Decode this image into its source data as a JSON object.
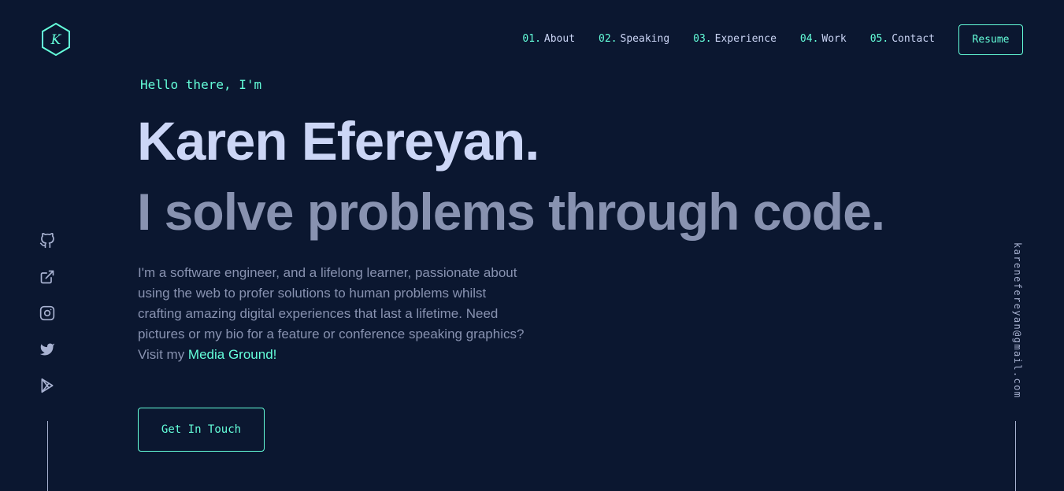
{
  "logo": {
    "letter": "K",
    "color": "#64ffda"
  },
  "nav": {
    "items": [
      {
        "num": "01.",
        "label": "About"
      },
      {
        "num": "02.",
        "label": "Speaking"
      },
      {
        "num": "03.",
        "label": "Experience"
      },
      {
        "num": "04.",
        "label": "Work"
      },
      {
        "num": "05.",
        "label": "Contact"
      }
    ],
    "resume_label": "Resume"
  },
  "hero": {
    "greeting": "Hello there, I'm",
    "name": "Karen Efereyan.",
    "tagline": "I solve problems through code.",
    "bio_text": "I'm a software engineer, and a lifelong learner, passionate about using the web to profer solutions to human problems whilst crafting amazing digital experiences that last a lifetime. Need pictures or my bio for a feature or conference speaking graphics? Visit my ",
    "bio_link": "Media Ground!",
    "cta_label": "Get In Touch"
  },
  "social": {
    "icons": [
      "github-icon",
      "external-link-icon",
      "instagram-icon",
      "twitter-icon",
      "play-store-icon"
    ]
  },
  "email": "karenefereyan@gmail.com",
  "colors": {
    "background": "#0b1730",
    "accent": "#64ffda",
    "heading": "#ccd6f6",
    "text": "#8892b0"
  }
}
